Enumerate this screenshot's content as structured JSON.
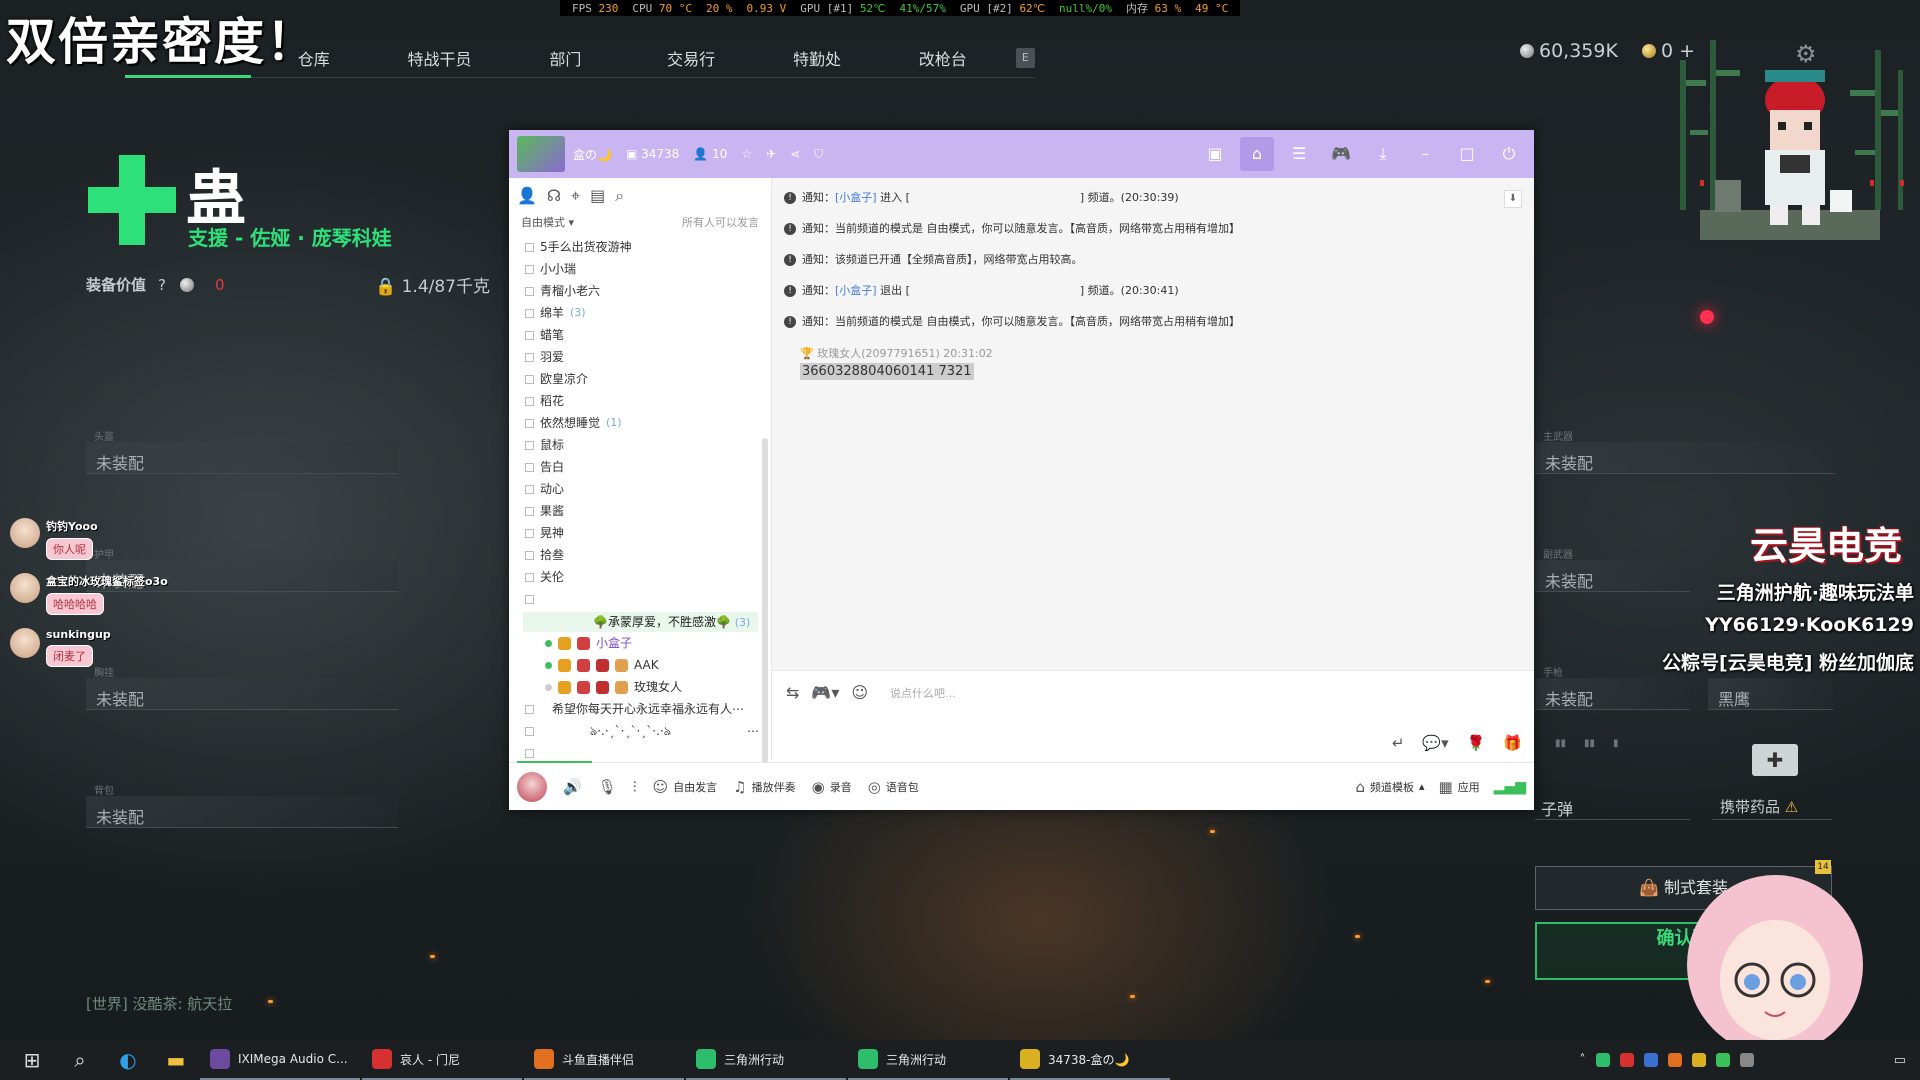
{
  "perf": [
    {
      "k": "FPS",
      "v": "230"
    },
    {
      "k": "CPU",
      "v": "70 °C"
    },
    {
      "k": "",
      "v": "20 %"
    },
    {
      "k": "",
      "v": "0.93 V"
    },
    {
      "k": "GPU [#1]",
      "v": "52℃"
    },
    {
      "k": "",
      "v": "41%/57%"
    },
    {
      "k": "GPU [#2]",
      "v": "62℃"
    },
    {
      "k": "",
      "v": "null%/0%"
    },
    {
      "k": "内存",
      "v": "63 %"
    },
    {
      "k": "",
      "v": "49 °C"
    }
  ],
  "banner": "双倍亲密度！",
  "nav": {
    "tabs": [
      "",
      "仓库",
      "特战干员",
      "部门",
      "交易行",
      "特勤处",
      "改枪台"
    ],
    "extra": "E"
  },
  "currency": {
    "silver": "60,359K",
    "gold": "0",
    "plus": "+"
  },
  "operator": {
    "name": "蛊",
    "subtitle": "支援 - 佐娅 · 庞琴科娃"
  },
  "equip": {
    "label": "装备价值",
    "help": "?",
    "value": "0",
    "weight": "1.4/87千克"
  },
  "left_slots": [
    {
      "tag": "头盔",
      "label": "未装配"
    },
    {
      "tag": "护甲",
      "label": "未装配"
    },
    {
      "tag": "胸挂",
      "label": "未装配"
    },
    {
      "tag": "背包",
      "label": "未装配"
    }
  ],
  "right_slots": [
    {
      "tag": "主武器",
      "label": "未装配"
    },
    {
      "tag": "副武器",
      "label": "未装配"
    },
    {
      "tag": "手枪",
      "label": "未装配"
    },
    {
      "tag": "",
      "label": "黑鹰"
    }
  ],
  "loadout": {
    "ammo": "子弹",
    "meds": "携带药品",
    "suit": "制式套装",
    "confirm": "确认配",
    "badge": "14"
  },
  "world_chat": "[世界] 没酷茶: 航天拉",
  "stream_chat": [
    {
      "name": "钓钓Yooo",
      "msg": "你人呢"
    },
    {
      "name": "盒宝的冰玫瑰鲨标签o3o",
      "msg": "哈哈哈哈"
    },
    {
      "name": "sunkingup",
      "msg": "闭麦了"
    }
  ],
  "overlay": {
    "brand": "云昊电竞",
    "lines": [
      "三角洲护航·趣味玩法单",
      "YY66129·KooK6129",
      "公粽号[云昊电竞] 粉丝加伽底"
    ]
  },
  "kook": {
    "title": {
      "server": "盒の🌙",
      "id": "34738",
      "members": "10"
    },
    "mode": "自由模式",
    "mode_right": "所有人可以发言",
    "channels": [
      {
        "name": "5手么出货夜游神",
        "count": ""
      },
      {
        "name": "小小瑞",
        "count": ""
      },
      {
        "name": "青榴小老六",
        "count": ""
      },
      {
        "name": "绵羊",
        "count": "(3)"
      },
      {
        "name": "蜡笔",
        "count": ""
      },
      {
        "name": "羽爱",
        "count": ""
      },
      {
        "name": "欧皇凉介",
        "count": ""
      },
      {
        "name": "稻花",
        "count": ""
      },
      {
        "name": "依然想睡觉",
        "count": "(1)"
      },
      {
        "name": "鼠标",
        "count": ""
      },
      {
        "name": "告白",
        "count": ""
      },
      {
        "name": "动心",
        "count": ""
      },
      {
        "name": "果酱",
        "count": ""
      },
      {
        "name": "晃神",
        "count": ""
      },
      {
        "name": "拾叁",
        "count": ""
      },
      {
        "name": "关伦",
        "count": ""
      }
    ],
    "active_channel": {
      "name": "承蒙厚爱，不胜感激",
      "count": "(3)"
    },
    "members": [
      {
        "name": "小盒子"
      },
      {
        "name": "AAK"
      },
      {
        "name": "玫瑰女人"
      }
    ],
    "after": [
      "希望你每天开心永远幸福永远有人⋯",
      "ঌ·.·ˏˋ·ˏˋ·ˏˋ·.·ঌ"
    ],
    "notices": [
      {
        "pre": "通知：",
        "user": "[小盒子]",
        "text": " 进入 [",
        "tail": "] 频道。(20:30:39)"
      },
      {
        "pre": "通知：",
        "user": "",
        "text": "当前频道的模式是 自由模式，你可以随意发言。【高音质，网络带宽占用稍有增加】",
        "tail": ""
      },
      {
        "pre": "通知：",
        "user": "",
        "text": "该频道已开通【全频高音质】，网络带宽占用较高。",
        "tail": ""
      },
      {
        "pre": "通知：",
        "user": "[小盒子]",
        "text": " 退出 [",
        "tail": "] 频道。(20:30:41)"
      },
      {
        "pre": "通知：",
        "user": "",
        "text": "当前频道的模式是 自由模式，你可以随意发言。【高音质，网络带宽占用稍有增加】",
        "tail": ""
      }
    ],
    "message": {
      "author": "玫瑰女人(2097791651)",
      "time": "20:31:02",
      "text": "3660328804060141 7321"
    },
    "input_placeholder": "说点什么吧...",
    "bottom": {
      "free": "自由发言",
      "music": "播放伴奏",
      "record": "录音",
      "voicepack": "语音包",
      "template": "频道模板",
      "apps": "应用"
    }
  },
  "taskbar": [
    {
      "label": "IXIMega Audio C...",
      "color": "#6b4aa0"
    },
    {
      "label": "哀人 - 门尼",
      "color": "#d63030"
    },
    {
      "label": "斗鱼直播伴侣",
      "color": "#e07020"
    },
    {
      "label": "三角洲行动",
      "color": "#2ebd6a"
    },
    {
      "label": "三角洲行动",
      "color": "#2ebd6a"
    },
    {
      "label": "34738-盒の🌙",
      "color": "#d8b020"
    }
  ]
}
